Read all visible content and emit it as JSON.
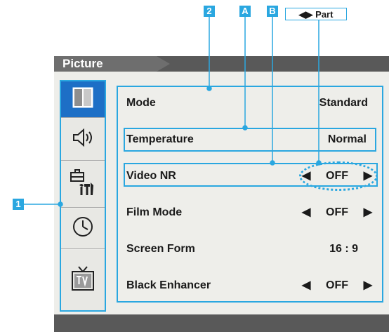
{
  "callouts": {
    "two": "2",
    "a": "A",
    "b": "B",
    "one": "1",
    "part": "Part"
  },
  "menu": {
    "title": "Picture",
    "rows": [
      {
        "label": "Mode",
        "value": "Standard"
      },
      {
        "label": "Temperature",
        "value": "Normal"
      },
      {
        "label": "Video NR",
        "value": "OFF"
      },
      {
        "label": "Film Mode",
        "value": "OFF"
      },
      {
        "label": "Screen Form",
        "value": "16 : 9"
      },
      {
        "label": "Black Enhancer",
        "value": "OFF"
      }
    ]
  },
  "sidebar": {
    "items": [
      {
        "icon": "picture-icon"
      },
      {
        "icon": "sound-icon"
      },
      {
        "icon": "setup-tools-icon"
      },
      {
        "icon": "clock-icon"
      },
      {
        "icon": "tv-icon"
      }
    ]
  },
  "colors": {
    "accent": "#2aa7e0",
    "active": "#1d6fc6",
    "bar": "#595959"
  }
}
